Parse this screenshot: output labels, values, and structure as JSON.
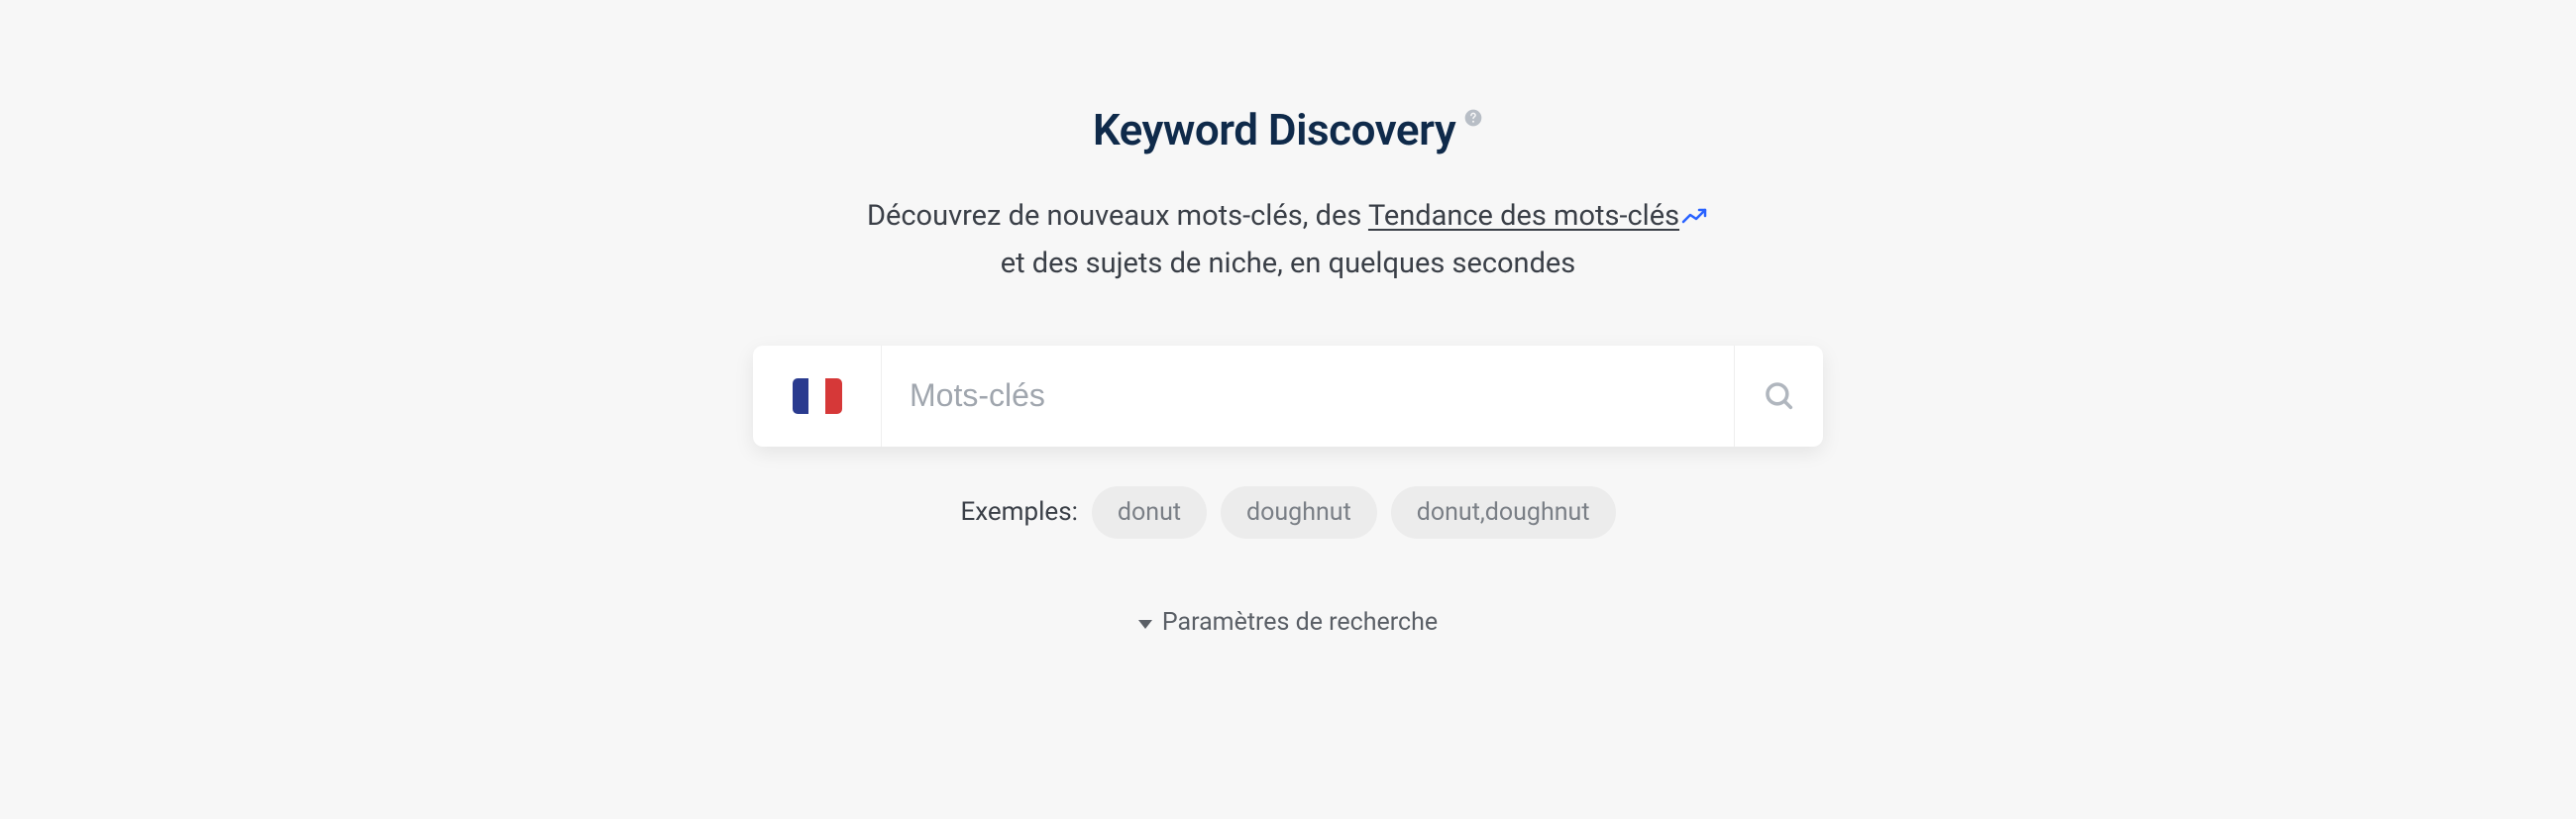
{
  "header": {
    "title": "Keyword Discovery"
  },
  "subtitle": {
    "part1": "Découvrez de nouveaux mots-clés, des ",
    "trend_link": "Tendance des mots-clés",
    "part2": "et des sujets de niche, en quelques secondes"
  },
  "search": {
    "placeholder": "Mots-clés",
    "country_code": "FR"
  },
  "examples": {
    "label": "Exemples:",
    "items": [
      "donut",
      "doughnut",
      "donut,doughnut"
    ]
  },
  "settings": {
    "label": "Paramètres de recherche"
  }
}
